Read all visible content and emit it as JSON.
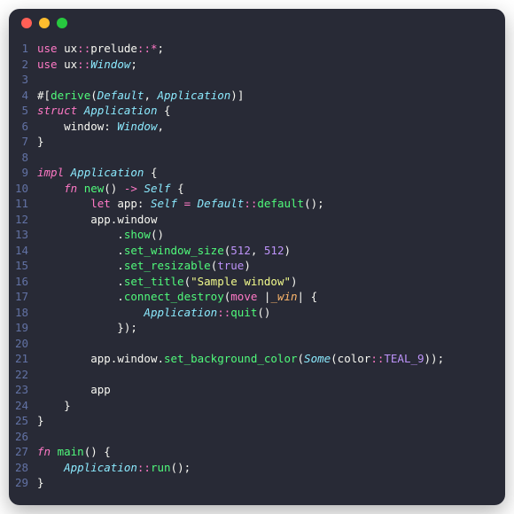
{
  "window": {
    "controls": [
      "close",
      "minimize",
      "zoom"
    ]
  },
  "code": {
    "language": "rust",
    "lines": [
      {
        "n": 1,
        "t": [
          [
            "kw",
            "use"
          ],
          [
            "punct",
            " "
          ],
          [
            "ns",
            "ux"
          ],
          [
            "op",
            "::"
          ],
          [
            "ns",
            "prelude"
          ],
          [
            "op",
            "::*"
          ],
          [
            "punct",
            ";"
          ]
        ]
      },
      {
        "n": 2,
        "t": [
          [
            "kw",
            "use"
          ],
          [
            "punct",
            " "
          ],
          [
            "ns",
            "ux"
          ],
          [
            "op",
            "::"
          ],
          [
            "ty",
            "Window"
          ],
          [
            "punct",
            ";"
          ]
        ]
      },
      {
        "n": 3,
        "t": [
          [
            "punct",
            ""
          ]
        ]
      },
      {
        "n": 4,
        "t": [
          [
            "punct",
            "#["
          ],
          [
            "attr",
            "derive"
          ],
          [
            "punct",
            "("
          ],
          [
            "ty",
            "Default"
          ],
          [
            "punct",
            ", "
          ],
          [
            "ty",
            "Application"
          ],
          [
            "punct",
            ")]"
          ]
        ]
      },
      {
        "n": 5,
        "t": [
          [
            "kw2",
            "struct"
          ],
          [
            "punct",
            " "
          ],
          [
            "ty",
            "Application"
          ],
          [
            "punct",
            " {"
          ]
        ]
      },
      {
        "n": 6,
        "t": [
          [
            "punct",
            "    "
          ],
          [
            "field",
            "window"
          ],
          [
            "punct",
            ": "
          ],
          [
            "ty",
            "Window"
          ],
          [
            "punct",
            ","
          ]
        ]
      },
      {
        "n": 7,
        "t": [
          [
            "punct",
            "}"
          ]
        ]
      },
      {
        "n": 8,
        "t": [
          [
            "punct",
            ""
          ]
        ]
      },
      {
        "n": 9,
        "t": [
          [
            "kw2",
            "impl"
          ],
          [
            "punct",
            " "
          ],
          [
            "ty",
            "Application"
          ],
          [
            "punct",
            " {"
          ]
        ]
      },
      {
        "n": 10,
        "t": [
          [
            "punct",
            "    "
          ],
          [
            "kw2",
            "fn"
          ],
          [
            "punct",
            " "
          ],
          [
            "fn",
            "new"
          ],
          [
            "punct",
            "() "
          ],
          [
            "op",
            "->"
          ],
          [
            "punct",
            " "
          ],
          [
            "ty",
            "Self"
          ],
          [
            "punct",
            " {"
          ]
        ]
      },
      {
        "n": 11,
        "t": [
          [
            "punct",
            "        "
          ],
          [
            "kw",
            "let"
          ],
          [
            "punct",
            " app: "
          ],
          [
            "ty",
            "Self"
          ],
          [
            "punct",
            " "
          ],
          [
            "op",
            "="
          ],
          [
            "punct",
            " "
          ],
          [
            "ty",
            "Default"
          ],
          [
            "op",
            "::"
          ],
          [
            "fn",
            "default"
          ],
          [
            "punct",
            "();"
          ]
        ]
      },
      {
        "n": 12,
        "t": [
          [
            "punct",
            "        app"
          ],
          [
            "punct",
            "."
          ],
          [
            "field",
            "window"
          ]
        ]
      },
      {
        "n": 13,
        "t": [
          [
            "punct",
            "            ."
          ],
          [
            "fn",
            "show"
          ],
          [
            "punct",
            "()"
          ]
        ]
      },
      {
        "n": 14,
        "t": [
          [
            "punct",
            "            ."
          ],
          [
            "fn",
            "set_window_size"
          ],
          [
            "punct",
            "("
          ],
          [
            "num",
            "512"
          ],
          [
            "punct",
            ", "
          ],
          [
            "num",
            "512"
          ],
          [
            "punct",
            ")"
          ]
        ]
      },
      {
        "n": 15,
        "t": [
          [
            "punct",
            "            ."
          ],
          [
            "fn",
            "set_resizable"
          ],
          [
            "punct",
            "("
          ],
          [
            "bool",
            "true"
          ],
          [
            "punct",
            ")"
          ]
        ]
      },
      {
        "n": 16,
        "t": [
          [
            "punct",
            "            ."
          ],
          [
            "fn",
            "set_title"
          ],
          [
            "punct",
            "("
          ],
          [
            "str",
            "\"Sample window\""
          ],
          [
            "punct",
            ")"
          ]
        ]
      },
      {
        "n": 17,
        "t": [
          [
            "punct",
            "            ."
          ],
          [
            "fn",
            "connect_destroy"
          ],
          [
            "punct",
            "("
          ],
          [
            "kw",
            "move"
          ],
          [
            "punct",
            " |"
          ],
          [
            "param",
            "_win"
          ],
          [
            "punct",
            "| {"
          ]
        ]
      },
      {
        "n": 18,
        "t": [
          [
            "punct",
            "                "
          ],
          [
            "ty",
            "Application"
          ],
          [
            "op",
            "::"
          ],
          [
            "fn",
            "quit"
          ],
          [
            "punct",
            "()"
          ]
        ]
      },
      {
        "n": 19,
        "t": [
          [
            "punct",
            "            });"
          ]
        ]
      },
      {
        "n": 20,
        "t": [
          [
            "punct",
            ""
          ]
        ]
      },
      {
        "n": 21,
        "t": [
          [
            "punct",
            "        app."
          ],
          [
            "field",
            "window"
          ],
          [
            "punct",
            "."
          ],
          [
            "fn",
            "set_background_color"
          ],
          [
            "punct",
            "("
          ],
          [
            "ty",
            "Some"
          ],
          [
            "punct",
            "(color"
          ],
          [
            "op",
            "::"
          ],
          [
            "const",
            "TEAL_9"
          ],
          [
            "punct",
            "));"
          ]
        ]
      },
      {
        "n": 22,
        "t": [
          [
            "punct",
            ""
          ]
        ]
      },
      {
        "n": 23,
        "t": [
          [
            "punct",
            "        app"
          ]
        ]
      },
      {
        "n": 24,
        "t": [
          [
            "punct",
            "    }"
          ]
        ]
      },
      {
        "n": 25,
        "t": [
          [
            "punct",
            "}"
          ]
        ]
      },
      {
        "n": 26,
        "t": [
          [
            "punct",
            ""
          ]
        ]
      },
      {
        "n": 27,
        "t": [
          [
            "kw2",
            "fn"
          ],
          [
            "punct",
            " "
          ],
          [
            "fn",
            "main"
          ],
          [
            "punct",
            "() {"
          ]
        ]
      },
      {
        "n": 28,
        "t": [
          [
            "punct",
            "    "
          ],
          [
            "ty",
            "Application"
          ],
          [
            "op",
            "::"
          ],
          [
            "fn",
            "run"
          ],
          [
            "punct",
            "();"
          ]
        ]
      },
      {
        "n": 29,
        "t": [
          [
            "punct",
            "}"
          ]
        ]
      }
    ]
  }
}
